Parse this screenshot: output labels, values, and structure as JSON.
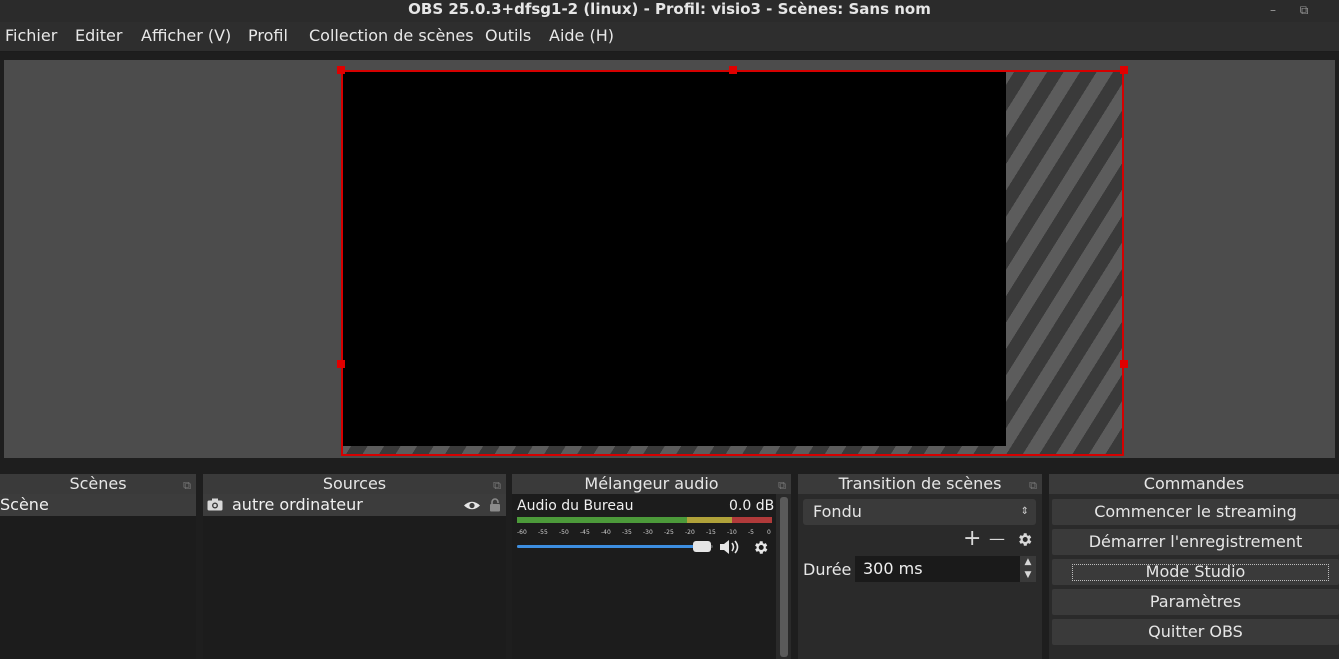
{
  "window": {
    "title": "OBS 25.0.3+dfsg1-2 (linux) - Profil: visio3 - Scènes: Sans nom",
    "minimize_glyph": "–",
    "maximize_glyph": "⧉"
  },
  "menu": [
    {
      "label": "Fichier"
    },
    {
      "label": "Editer"
    },
    {
      "label": "Afficher (V)"
    },
    {
      "label": "Profil"
    },
    {
      "label": "Collection de scènes"
    },
    {
      "label": "Outils"
    },
    {
      "label": "Aide (H)"
    }
  ],
  "docks": {
    "scenes": {
      "title": "Scènes",
      "items": [
        {
          "label": "Scène"
        }
      ]
    },
    "sources": {
      "title": "Sources",
      "items": [
        {
          "label": "autre ordinateur",
          "icon": "camera-icon"
        }
      ]
    },
    "mixer": {
      "title": "Mélangeur audio",
      "channel": "Audio du Bureau",
      "level": "0.0 dB",
      "volume_fraction": 0.97,
      "ticks": [
        "-60",
        "-55",
        "-50",
        "-45",
        "-40",
        "-35",
        "-30",
        "-25",
        "-20",
        "-15",
        "-10",
        "-5",
        "0"
      ]
    },
    "transitions": {
      "title": "Transition de scènes",
      "selected": "Fondu",
      "duration_label": "Durée",
      "duration_value": "300 ms",
      "add_glyph": "+",
      "remove_glyph": "—"
    },
    "controls": {
      "title": "Commandes",
      "buttons": [
        {
          "label": "Commencer le streaming"
        },
        {
          "label": "Démarrer l'enregistrement"
        },
        {
          "label": "Mode Studio"
        },
        {
          "label": "Paramètres"
        },
        {
          "label": "Quitter OBS"
        }
      ]
    }
  },
  "colors": {
    "selection_outline": "#d60000",
    "volume_slider": "#3d8ee0",
    "meter_green": "#4c9a3a",
    "meter_yellow": "#b0a23a",
    "meter_red": "#b03a3a"
  }
}
